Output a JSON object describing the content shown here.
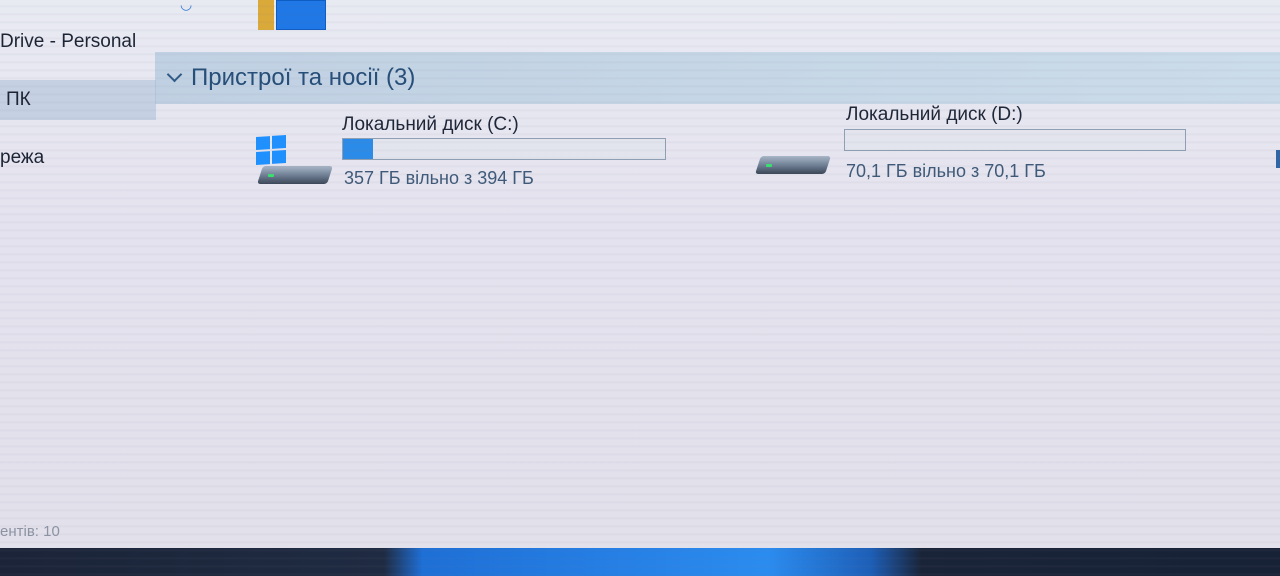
{
  "nav": {
    "items": [
      {
        "label": "Drive - Personal"
      },
      {
        "label": "ПК"
      },
      {
        "label": "режа"
      }
    ],
    "selected_index": 1
  },
  "group": {
    "title": "Пристрої та носії (3)"
  },
  "drives": [
    {
      "name": "Локальний диск (C:)",
      "free_text": "357 ГБ вільно з 394 ГБ",
      "used_fraction": 0.094,
      "icon": "windows-drive-icon"
    },
    {
      "name": "Локальний диск (D:)",
      "free_text": "70,1 ГБ вільно з 70,1 ГБ",
      "used_fraction": 0.0,
      "icon": "hard-drive-icon"
    }
  ],
  "status": {
    "items_text": "ентів: 10"
  },
  "colors": {
    "accent": "#2b8be8",
    "group_header_text": "#264e78"
  }
}
